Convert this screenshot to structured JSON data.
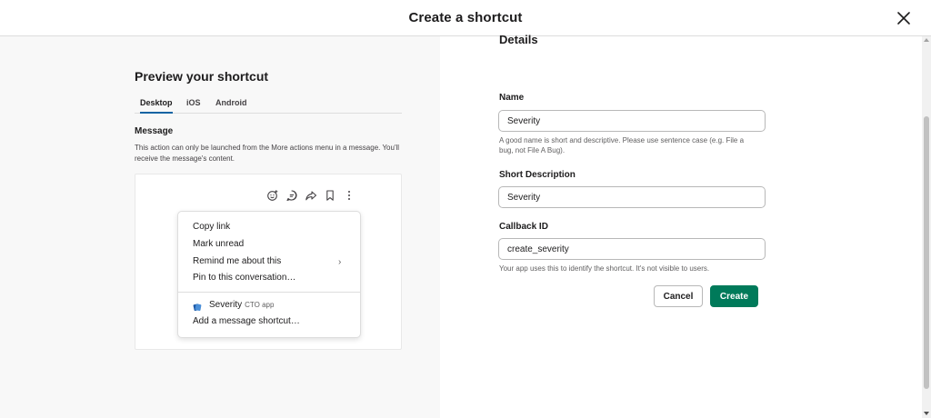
{
  "modal": {
    "title": "Create a shortcut"
  },
  "preview": {
    "title": "Preview your shortcut",
    "tabs": [
      {
        "label": "Desktop",
        "active": true
      },
      {
        "label": "iOS",
        "active": false
      },
      {
        "label": "Android",
        "active": false
      }
    ],
    "section_label": "Message",
    "section_desc": "This action can only be launched from the More actions menu in a message. You'll receive the message's content.",
    "message_actions": [
      "add-reaction-icon",
      "reply-in-thread-icon",
      "share-message-icon",
      "bookmark-icon",
      "more-actions-icon"
    ],
    "menu": {
      "items": [
        "Copy link",
        "Mark unread",
        "Remind me about this",
        "Pin to this conversation…"
      ],
      "submenu_chevron": "›",
      "app_name": "Severity",
      "app_sub": "CTO app",
      "add_shortcut": "Add a message shortcut…"
    }
  },
  "details": {
    "title": "Details",
    "name_label": "Name",
    "name_value": "Severity",
    "name_hint": "A good name is short and descriptive. Please use sentence case (e.g. File a bug, not File A Bug).",
    "short_desc_label": "Short Description",
    "short_desc_value": "Severity",
    "callback_label": "Callback ID",
    "callback_value": "create_severity",
    "callback_hint": "Your app uses this to identify the shortcut. It's not visible to users."
  },
  "buttons": {
    "cancel": "Cancel",
    "create": "Create"
  },
  "colors": {
    "primary": "#007a5a",
    "tab_underline": "#1264a3",
    "left_background": "#f8f8f8"
  }
}
